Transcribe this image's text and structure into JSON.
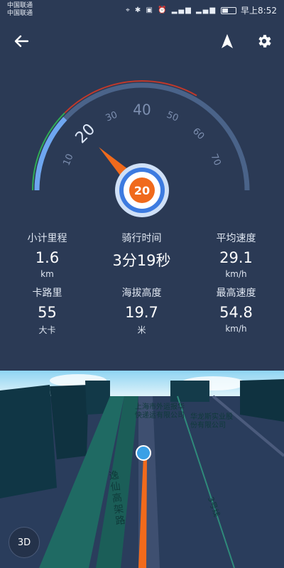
{
  "status_bar": {
    "carrier1": "中国联通",
    "carrier2": "中国联通",
    "time": "早上8:52",
    "battery_level": 0.45
  },
  "top_bar": {
    "back_icon": "back-arrow-icon",
    "navigate_icon": "navigation-arrow-icon",
    "settings_icon": "gear-icon"
  },
  "gauge": {
    "current_speed": "20",
    "tick_labels": [
      "10",
      "20",
      "30",
      "40",
      "50",
      "60",
      "70"
    ],
    "min": 0,
    "max": 80,
    "speed_value": 20
  },
  "stats": [
    {
      "label": "小计里程",
      "value": "1.6",
      "unit": "km"
    },
    {
      "label": "骑行时间",
      "value": "3分19秒",
      "unit": ""
    },
    {
      "label": "平均速度",
      "value": "29.1",
      "unit": "km/h"
    },
    {
      "label": "卡路里",
      "value": "55",
      "unit": "大卡"
    },
    {
      "label": "海拔高度",
      "value": "19.7",
      "unit": "米"
    },
    {
      "label": "最高速度",
      "value": "54.8",
      "unit": "km/h"
    }
  ],
  "map": {
    "label_company1_line1": "上海市外运报华",
    "label_company1_line2": "快递运有限公司",
    "label_company2_line1": "华龙斯实业股",
    "label_company2_line2": "份有限公司",
    "road_name": "逸仙高架路",
    "line_name": "3号线",
    "view_mode_button": "3D"
  }
}
